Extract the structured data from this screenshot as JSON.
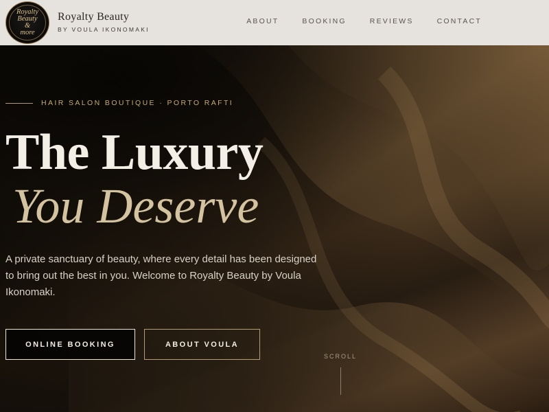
{
  "brand": {
    "logo_text": "Royalty Beauty\n&\nmore",
    "name": "Royalty Beauty",
    "tagline": "BY VOULA IKONOMAKI"
  },
  "nav": {
    "items": [
      "ABOUT",
      "BOOKING",
      "REVIEWS",
      "CONTACT"
    ]
  },
  "hero": {
    "eyebrow": "HAIR SALON BOUTIQUE · PORTO RAFTI",
    "title_line1": "The Luxury",
    "title_line2": "You Deserve",
    "lead": "A private sanctuary of beauty, where every detail has been designed to bring out the best in you. Welcome to Royalty Beauty by Voula Ikonomaki.",
    "primary_button": "ONLINE BOOKING",
    "secondary_button": "ABOUT VOULA",
    "scroll_label": "SCROLL"
  },
  "colors": {
    "header_bg": "#e6e3de",
    "accent_gold": "#c5ab74",
    "title_italic": "#d3c3a0",
    "hero_dark": "#0d0a07"
  }
}
